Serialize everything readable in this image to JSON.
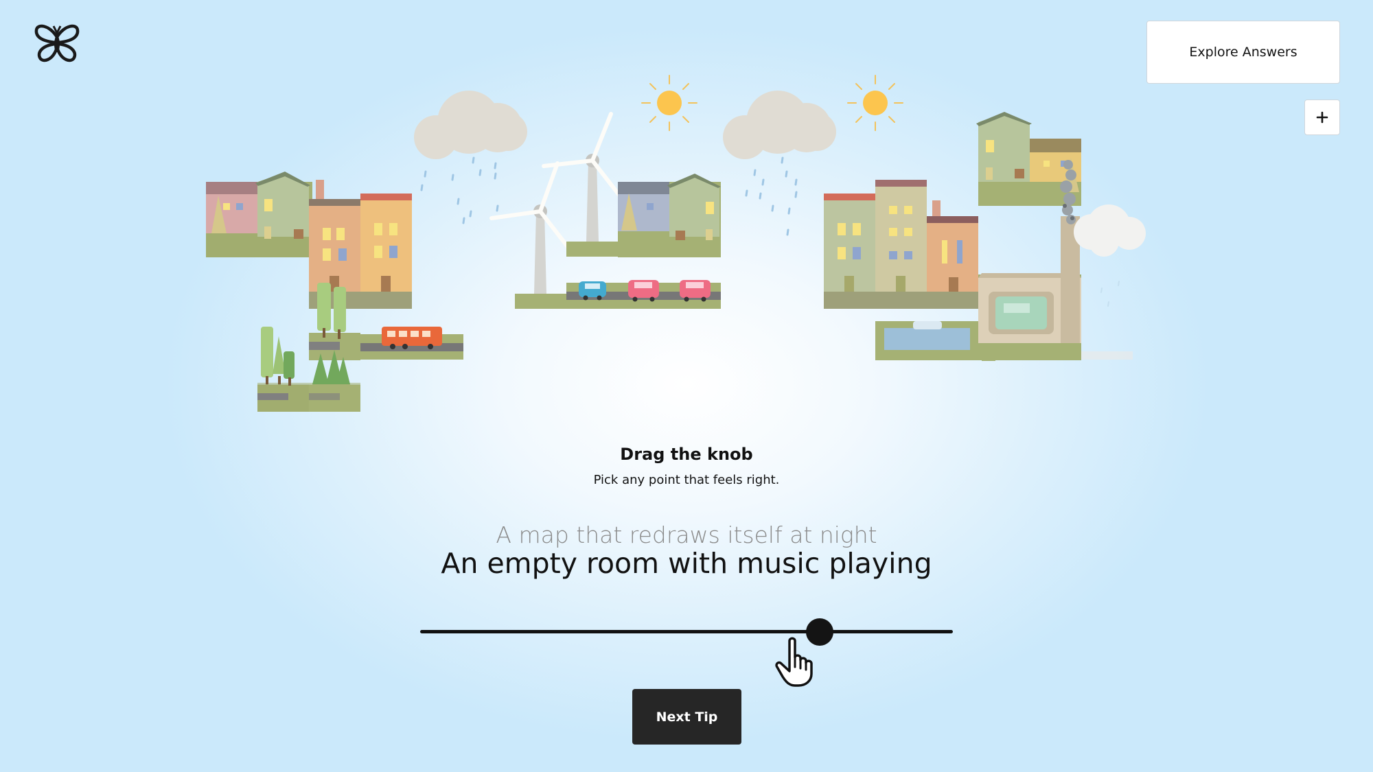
{
  "header": {
    "logo_icon": "butterfly-icon",
    "explore_label": "Explore Answers",
    "expand_label": "+"
  },
  "instructions": {
    "title": "Drag the knob",
    "subtitle": "Pick any point that feels right."
  },
  "prompt": {
    "previous": "A map that redraws itself at night",
    "current": "An empty room with music playing"
  },
  "slider": {
    "value_fraction": 0.75,
    "cursor_icon": "pointing-hand-icon"
  },
  "footer": {
    "next_label": "Next Tip"
  },
  "colors": {
    "knob": "#141414",
    "track": "#111111",
    "next_button": "#262626",
    "sun": "#fcc54e"
  }
}
